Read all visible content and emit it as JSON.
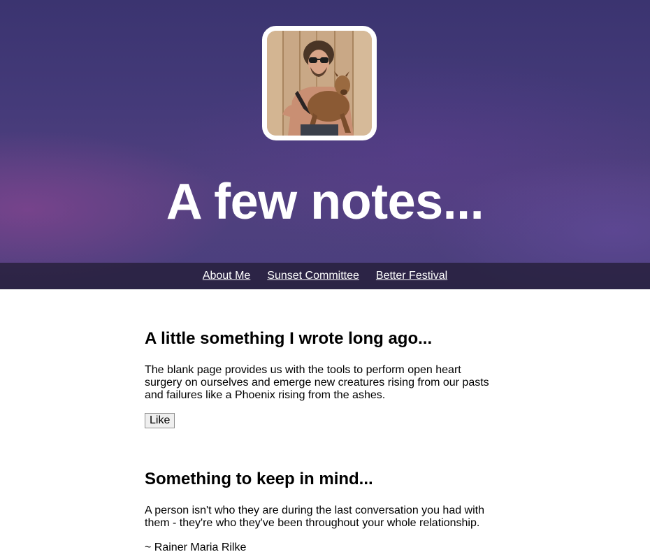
{
  "header": {
    "title": "A few notes...",
    "avatar_icon": "profile-photo"
  },
  "nav": {
    "items": [
      {
        "label": "About Me"
      },
      {
        "label": "Sunset Committee"
      },
      {
        "label": "Better Festival"
      }
    ]
  },
  "posts": [
    {
      "title": "A little something I wrote long ago...",
      "body": "The blank page provides us with the tools to perform open heart surgery on ourselves and emerge new creatures rising from our pasts and failures like a Phoenix rising from the ashes.",
      "button_label": "Like"
    },
    {
      "title": "Something to keep in mind...",
      "body": "A person isn't who they are during the last conversation you had with them - they're who they've been throughout your whole relationship.",
      "attribution": "~ Rainer Maria Rilke"
    }
  ],
  "colors": {
    "hero_top": "#3b3470",
    "hero_bottom": "#4a3f7d",
    "navbar_bg": "#201a30",
    "title_text": "#ffffff"
  }
}
